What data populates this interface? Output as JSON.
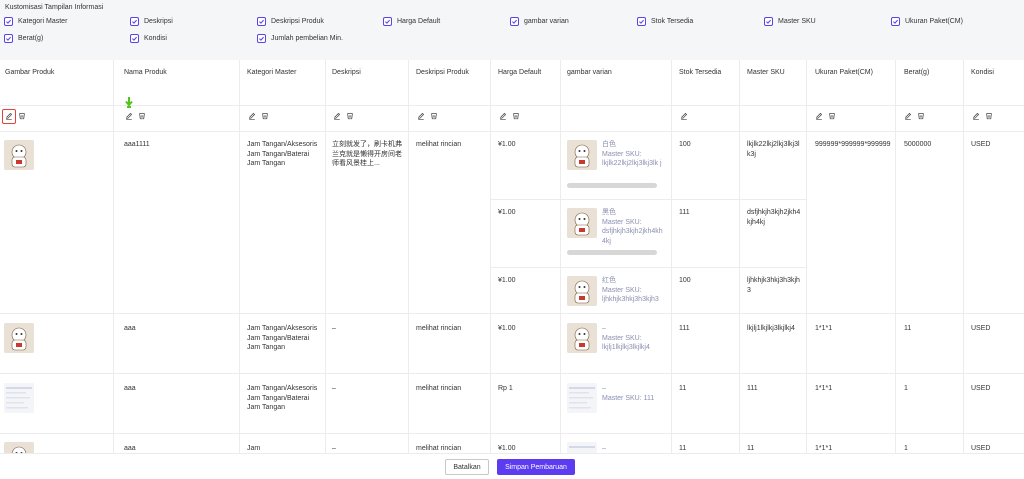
{
  "customization": {
    "title": "Kustomisasi Tampilan Informasi",
    "options": [
      {
        "label": "Kategori Master",
        "checked": true
      },
      {
        "label": "Deskripsi",
        "checked": true
      },
      {
        "label": "Deskripsi Produk",
        "checked": true
      },
      {
        "label": "Harga Default",
        "checked": true
      },
      {
        "label": "gambar varian",
        "checked": true
      },
      {
        "label": "Stok Tersedia",
        "checked": true
      },
      {
        "label": "Master SKU",
        "checked": true
      },
      {
        "label": "Ukuran Paket(CM)",
        "checked": true
      },
      {
        "label": "Berat(g)",
        "checked": true
      },
      {
        "label": "Kondisi",
        "checked": true
      },
      {
        "label": "Jumlah pembelian Min.",
        "checked": true
      }
    ]
  },
  "table": {
    "headers": [
      "Gambar Produk",
      "Nama Produk",
      "Kategori Master",
      "Deskripsi",
      "Deskripsi Produk",
      "Harga Default",
      "gambar varian",
      "Stok Tersedia",
      "Master SKU",
      "Ukuran Paket(CM)",
      "Berat(g)",
      "Kondisi"
    ],
    "rows": [
      {
        "name": "aaa1111",
        "category": "Jam Tangan/Aksesoris Jam Tangan/Baterai Jam Tangan",
        "description": "立刻就发了，刷卡机弗兰克就是懒得开房间老师看风景桂上...",
        "product_desc": "melihat rincian",
        "package": "999999*999999*999999",
        "weight": "5000000",
        "condition": "USED",
        "variants": [
          {
            "price": "¥1.00",
            "name": "白色",
            "sku_label": "Master SKU:",
            "sku": "lkjlk22lkj2lkj3lkj3lk j",
            "stock": "100",
            "master_sku": "lkjlk22lkj2lkj3lkj3lk3j"
          },
          {
            "price": "¥1.00",
            "name": "黑色",
            "sku_label": "Master SKU:",
            "sku": "dsfjhkjh3kjh2jkh4kh4kj",
            "stock": "111",
            "master_sku": "dsfjhkjh3kjh2jkh4kjh4kj"
          },
          {
            "price": "¥1.00",
            "name": "红色",
            "sku_label": "Master SKU:",
            "sku": "ljhkhjk3hkj3h3kjh3",
            "stock": "100",
            "master_sku": "ljhkhjk3hkj3h3kjh3"
          }
        ]
      },
      {
        "name": "aaa",
        "category": "Jam Tangan/Aksesoris Jam Tangan/Baterai Jam Tangan",
        "description": "–",
        "product_desc": "melihat rincian",
        "price": "¥1.00",
        "variant_name": "–",
        "variant_sku_label": "Master SKU:",
        "variant_sku": "lkjlj1lkjlkj3lkjlkj4",
        "stock": "111",
        "master_sku": "lkjlj1lkjlkj3lkjlkj4",
        "package": "1*1*1",
        "weight": "11",
        "condition": "USED"
      },
      {
        "name": "aaa",
        "category": "Jam Tangan/Aksesoris Jam Tangan/Baterai Jam Tangan",
        "description": "–",
        "product_desc": "melihat rincian",
        "price": "Rp 1",
        "variant_name": "–",
        "variant_sku": "Master SKU: 111",
        "stock": "11",
        "master_sku": "111",
        "package": "1*1*1",
        "weight": "1",
        "condition": "USED"
      },
      {
        "name": "aaa",
        "category": "Jam",
        "description": "–",
        "product_desc": "melihat rincian",
        "price": "¥1.00",
        "variant_name": "–",
        "stock": "11",
        "master_sku": "11",
        "package": "1*1*1",
        "weight": "1",
        "condition": "USED"
      }
    ]
  },
  "footer": {
    "cancel_label": "Batalkan",
    "save_label": "Simpan Pembaruan"
  },
  "colors": {
    "accent": "#5b3cf0",
    "highlight": "#e0433a",
    "marker": "#52c41a"
  }
}
